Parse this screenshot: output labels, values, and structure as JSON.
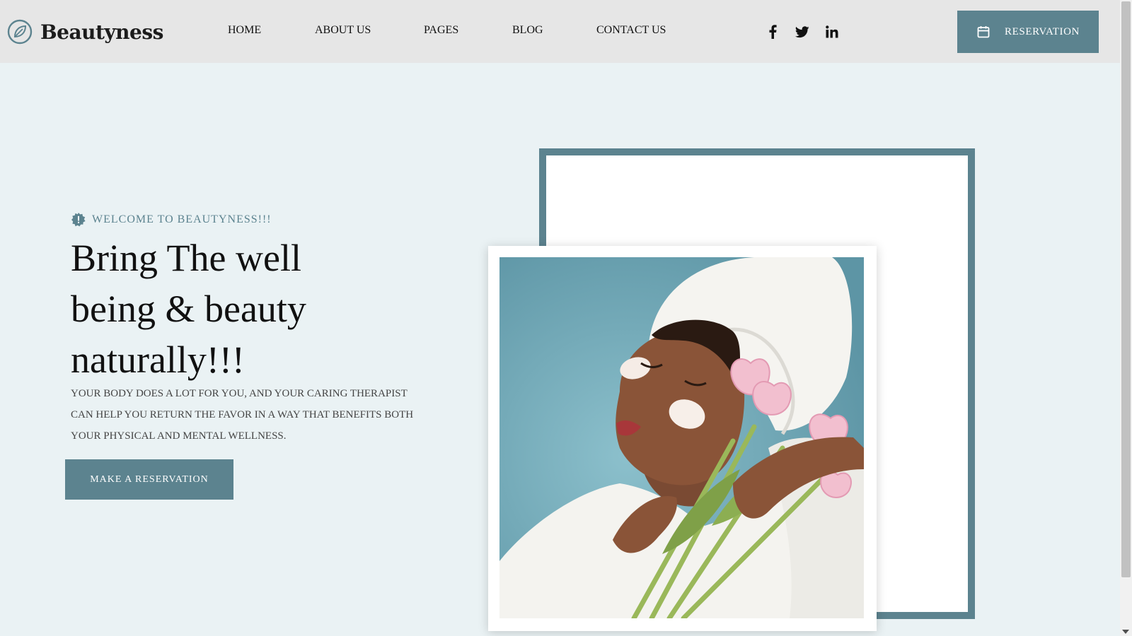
{
  "header": {
    "logo_text": "Beautyness",
    "nav": [
      {
        "label": "HOME"
      },
      {
        "label": "ABOUT US"
      },
      {
        "label": "PAGES"
      },
      {
        "label": "BLOG"
      },
      {
        "label": "CONTACT US"
      }
    ],
    "social_icons": [
      "facebook-icon",
      "twitter-icon",
      "linkedin-icon"
    ],
    "reservation_label": "RESERVATION"
  },
  "hero": {
    "welcome": "WELCOME TO BEAUTYNESS!!!",
    "headline": "Bring The well being & beauty naturally!!!",
    "description": "YOUR BODY DOES A LOT FOR YOU, AND YOUR CARING THERAPIST CAN HELP YOU RETURN THE FAVOR IN A WAY THAT BENEFITS BOTH YOUR PHYSICAL AND MENTAL WELLNESS.",
    "cta_label": "MAKE A RESERVATION"
  },
  "colors": {
    "accent": "#5c838f",
    "page_background": "#eaf2f4",
    "header_background": "#e6e6e6"
  }
}
